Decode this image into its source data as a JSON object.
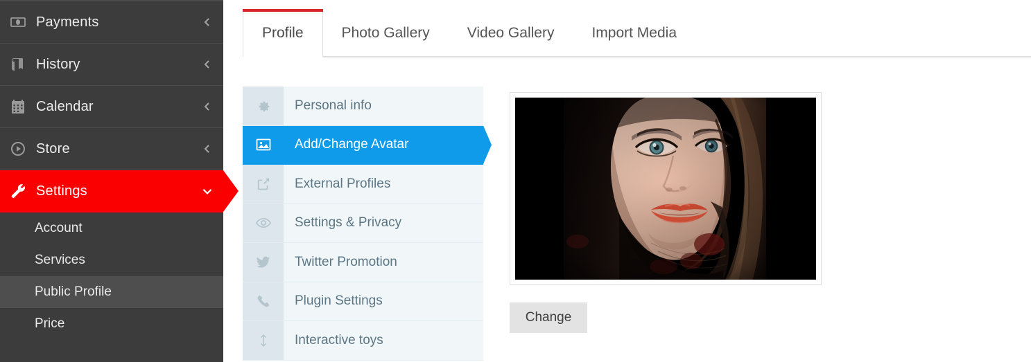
{
  "sidebar": {
    "items": [
      {
        "label": "Payments",
        "icon": "money-icon",
        "caret": "chevron-left-icon",
        "state": "collapsed"
      },
      {
        "label": "History",
        "icon": "book-icon",
        "caret": "chevron-left-icon",
        "state": "collapsed"
      },
      {
        "label": "Calendar",
        "icon": "calendar-icon",
        "caret": "chevron-left-icon",
        "state": "collapsed"
      },
      {
        "label": "Store",
        "icon": "play-circle-icon",
        "caret": "chevron-left-icon",
        "state": "collapsed"
      },
      {
        "label": "Settings",
        "icon": "wrench-icon",
        "caret": "chevron-down-icon",
        "state": "expanded"
      }
    ],
    "subitems": [
      {
        "label": "Account",
        "selected": false
      },
      {
        "label": "Services",
        "selected": false
      },
      {
        "label": "Public Profile",
        "selected": true
      },
      {
        "label": "Price",
        "selected": false
      }
    ],
    "colors": {
      "background": "#3c3c3c",
      "active": "#fb0000",
      "selected_sub": "#4e4e4e"
    }
  },
  "tabs": [
    {
      "label": "Profile",
      "active": true
    },
    {
      "label": "Photo Gallery",
      "active": false
    },
    {
      "label": "Video Gallery",
      "active": false
    },
    {
      "label": "Import Media",
      "active": false
    }
  ],
  "vmenu": {
    "items": [
      {
        "label": "Personal info",
        "icon": "gear-icon",
        "active": false
      },
      {
        "label": "Add/Change Avatar",
        "icon": "image-icon",
        "active": true
      },
      {
        "label": "External Profiles",
        "icon": "external-link-icon",
        "active": false
      },
      {
        "label": "Settings & Privacy",
        "icon": "eye-icon",
        "active": false
      },
      {
        "label": "Twitter Promotion",
        "icon": "twitter-icon",
        "active": false
      },
      {
        "label": "Plugin Settings",
        "icon": "phone-icon",
        "active": false
      },
      {
        "label": "Interactive toys",
        "icon": "arrows-vertical-icon",
        "active": false
      }
    ],
    "active_color": "#0f9bea"
  },
  "avatar": {
    "alt": "user-avatar-photo",
    "change_button_label": "Change"
  },
  "theme": {
    "tab_accent": "#d8232a",
    "menu_accent": "#0f9bea",
    "sidebar_accent": "#fb0000"
  }
}
